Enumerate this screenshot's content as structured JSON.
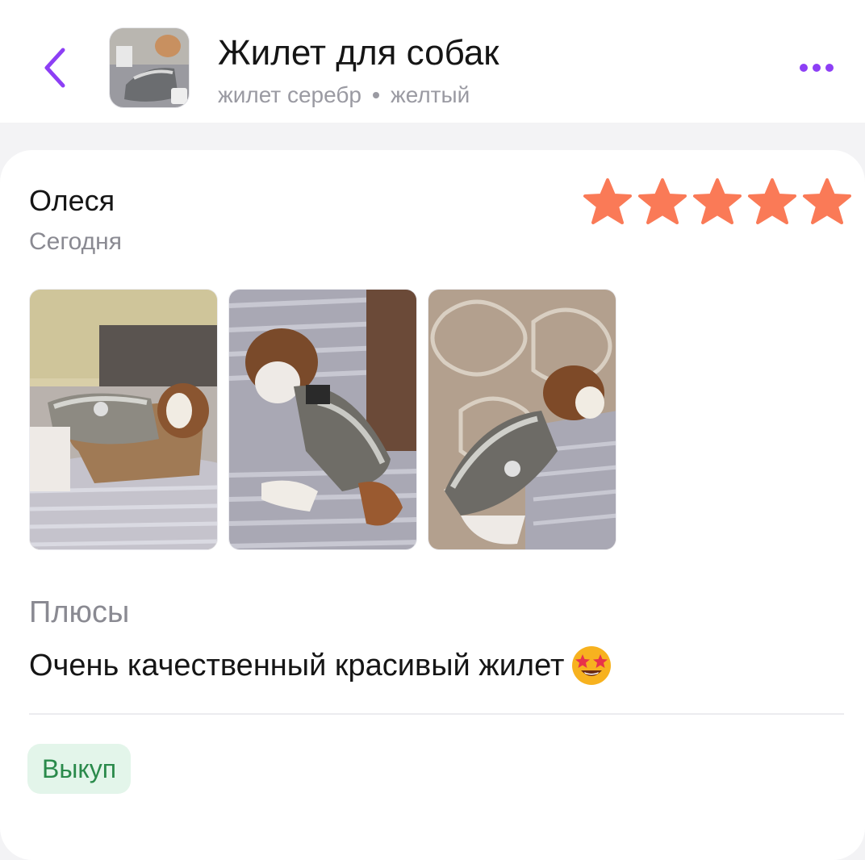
{
  "header": {
    "title": "Жилет для собак",
    "variant_color": "жилет серебр",
    "variant_size": "желтый",
    "accent_color": "#8d3ff5"
  },
  "review": {
    "author": "Олеся",
    "date": "Сегодня",
    "rating": 5,
    "rating_max": 5,
    "star_color": "#fa7a57",
    "photos": [
      "dog-photo-1",
      "dog-photo-2",
      "dog-photo-3"
    ],
    "pros_title": "Плюсы",
    "pros_text": "Очень качественный красивый жилет",
    "pros_emoji": "star-struck-emoji",
    "badge": "Выкуп",
    "badge_color": "#2a8a4b"
  },
  "icons": {
    "back": "chevron-left-icon",
    "more": "more-dots-icon",
    "star": "star-icon"
  }
}
